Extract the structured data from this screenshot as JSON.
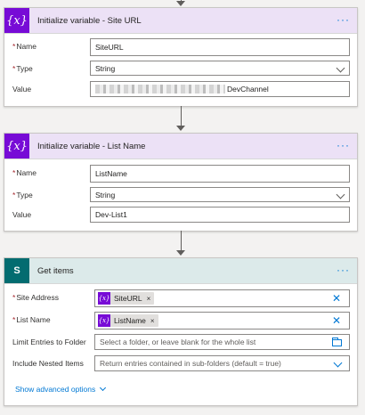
{
  "cards": {
    "site_url": {
      "icon": "variable-icon",
      "title": "Initialize variable - Site URL",
      "menu": "···",
      "name_label": "Name",
      "name_value": "SiteURL",
      "type_label": "Type",
      "type_value": "String",
      "value_label": "Value",
      "value_suffix": "DevChannel"
    },
    "list_name": {
      "icon": "variable-icon",
      "title": "Initialize variable - List Name",
      "menu": "···",
      "name_label": "Name",
      "name_value": "ListName",
      "type_label": "Type",
      "type_value": "String",
      "value_label": "Value",
      "value_value": "Dev-List1"
    },
    "get_items": {
      "icon": "sharepoint-icon",
      "title": "Get items",
      "menu": "···",
      "site_label": "Site Address",
      "site_token": "SiteURL",
      "list_label": "List Name",
      "list_token": "ListName",
      "limit_label": "Limit Entries to Folder",
      "limit_placeholder": "Select a folder, or leave blank for the whole list",
      "nested_label": "Include Nested Items",
      "nested_value": "Return entries contained in sub-folders (default = true)",
      "advanced_link": "Show advanced options"
    }
  },
  "glyphs": {
    "required": "*",
    "variable": "{x}",
    "sharepoint": "S",
    "token_remove": "×",
    "clear": "✕"
  },
  "colors": {
    "variable_accent": "#770bd6",
    "variable_header": "#ece1f6",
    "sharepoint_accent": "#036c70",
    "sharepoint_header": "#dceaea",
    "link": "#0078d4",
    "required": "#a4262c"
  }
}
